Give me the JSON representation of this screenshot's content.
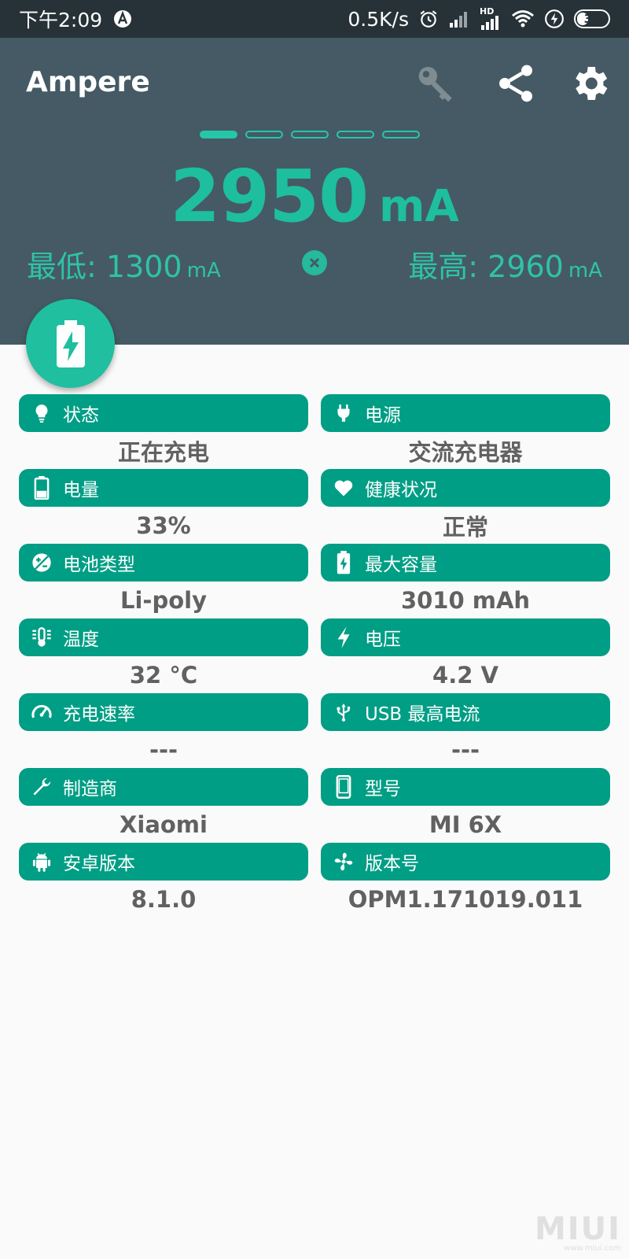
{
  "status_bar": {
    "time": "下午2:09",
    "network_speed": "0.5K/s",
    "network_type": "HD",
    "battery_level": "33",
    "icons": [
      "a-badge-icon",
      "alarm-icon",
      "signal-icon",
      "hd-signal-icon",
      "wifi-icon",
      "charging-icon",
      "battery-icon"
    ]
  },
  "header": {
    "title": "Ampere",
    "actions": [
      "key-icon",
      "share-icon",
      "settings-icon"
    ],
    "current": {
      "value": "2950",
      "unit": "mA"
    },
    "min": {
      "label": "最低:",
      "value": "1300",
      "unit": "mA"
    },
    "max": {
      "label": "最高:",
      "value": "2960",
      "unit": "mA"
    },
    "pager": {
      "count": 5,
      "active": 0
    }
  },
  "cards": [
    {
      "label": "状态",
      "value": "正在充电",
      "icon": "lightbulb-icon"
    },
    {
      "label": "电源",
      "value": "交流充电器",
      "icon": "plug-icon"
    },
    {
      "label": "电量",
      "value": "33%",
      "icon": "battery-level-icon"
    },
    {
      "label": "健康状况",
      "value": "正常",
      "icon": "heart-icon"
    },
    {
      "label": "电池类型",
      "value": "Li-poly",
      "icon": "battery-type-icon"
    },
    {
      "label": "最大容量",
      "value": "3010 mAh",
      "icon": "battery-charging-icon"
    },
    {
      "label": "温度",
      "value": "32 °C",
      "icon": "thermometer-icon"
    },
    {
      "label": "电压",
      "value": "4.2 V",
      "icon": "lightning-icon"
    },
    {
      "label": "充电速率",
      "value": "---",
      "icon": "speedometer-icon"
    },
    {
      "label": "USB 最高电流",
      "value": "---",
      "icon": "usb-icon"
    },
    {
      "label": "制造商",
      "value": "Xiaomi",
      "icon": "wrench-icon"
    },
    {
      "label": "型号",
      "value": "MI 6X",
      "icon": "phone-icon"
    },
    {
      "label": "安卓版本",
      "value": "8.1.0",
      "icon": "android-icon"
    },
    {
      "label": "版本号",
      "value": "OPM1.171019.011",
      "icon": "fan-icon"
    }
  ],
  "colors": {
    "status_bar": "#263238",
    "header": "#455a64",
    "accent": "#1dbf9e",
    "card": "#009e85",
    "value_text": "#616161"
  },
  "watermark": {
    "text": "MIUI",
    "sub": "www.miui.com"
  }
}
